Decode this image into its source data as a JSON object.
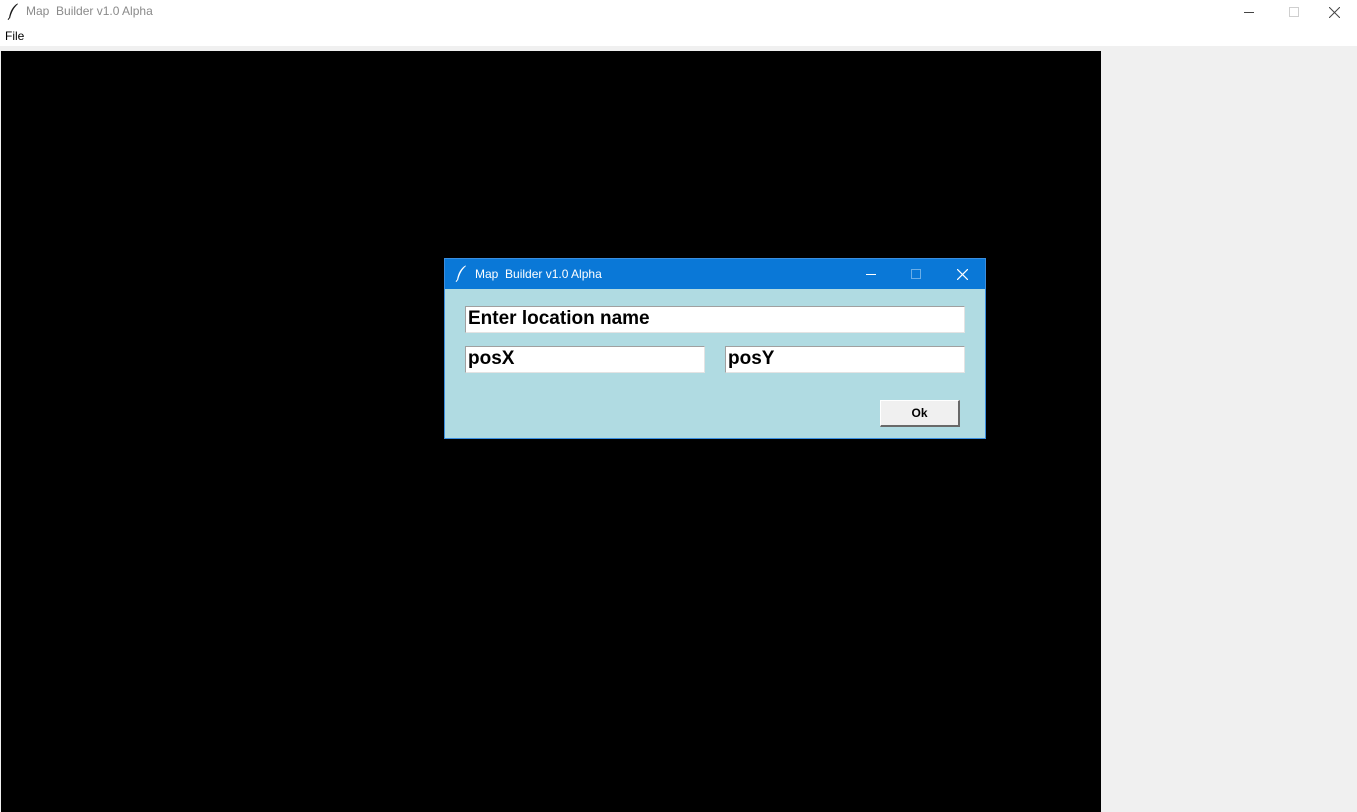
{
  "window": {
    "title": "Map  Builder v1.0 Alpha",
    "icon": "feather-icon",
    "controls": [
      "minimize-icon",
      "maximize-icon",
      "close-icon"
    ]
  },
  "menubar": {
    "items": [
      {
        "label": "File"
      }
    ]
  },
  "dialog": {
    "title": "Map  Builder v1.0 Alpha",
    "icon": "feather-icon",
    "location_name_value": "Enter location name",
    "pos_x_value": "posX",
    "pos_y_value": "posY",
    "ok_label": "Ok"
  },
  "colors": {
    "canvas": "#000000",
    "side_panel": "#f0f0f0",
    "dialog_bg": "#b0dbe2",
    "dialog_titlebar": "#0a78d7"
  }
}
